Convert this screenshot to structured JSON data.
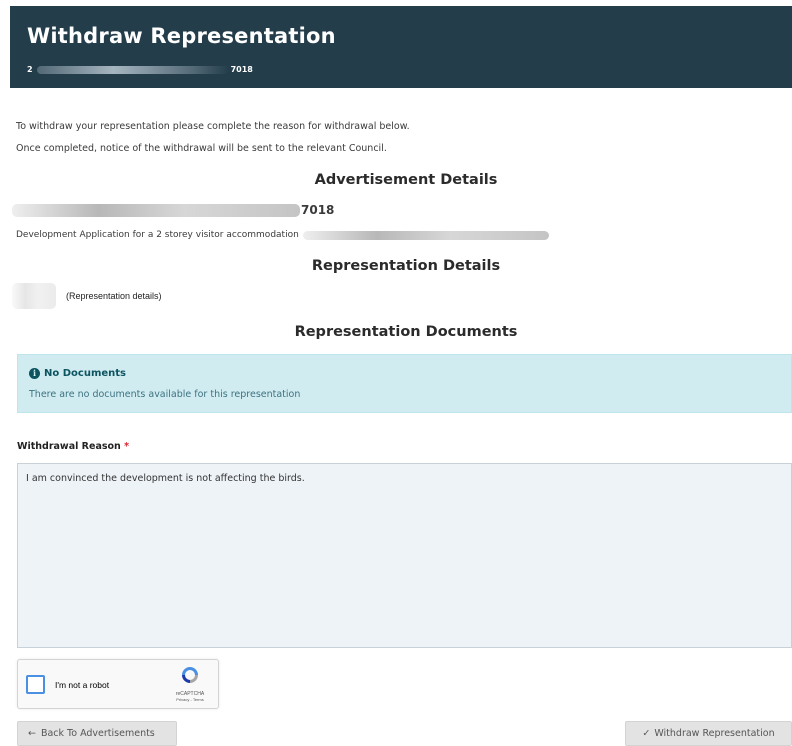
{
  "header": {
    "title": "Withdraw Representation",
    "ref_prefix": "2",
    "ref_suffix": "7018"
  },
  "intro": {
    "line1": "To withdraw your representation please complete the reason for withdrawal below.",
    "line2": "Once completed, notice of the withdrawal will be sent to the relevant Council."
  },
  "advertisement": {
    "heading": "Advertisement Details",
    "ref_suffix": "7018",
    "description": "Development Application for a 2 storey visitor accommodation"
  },
  "representation": {
    "heading": "Representation Details",
    "details_text": "(Representation details)"
  },
  "documents": {
    "heading": "Representation Documents",
    "alert_title": "No Documents",
    "alert_text": "There are no documents available for this representation"
  },
  "form": {
    "reason_label": "Withdrawal Reason",
    "required_marker": "*",
    "reason_value": "I am convinced the development is not affecting the birds."
  },
  "captcha": {
    "label": "I'm not a robot",
    "brand": "reCAPTCHA",
    "terms": "Privacy - Terms"
  },
  "buttons": {
    "back_icon": "←",
    "back_label": "Back To Advertisements",
    "withdraw_icon": "✓",
    "withdraw_label": "Withdraw Representation"
  },
  "colors": {
    "header_bg": "#233d4b",
    "alert_bg": "#d1ecf1",
    "alert_text": "#0c5460",
    "required": "#d9232e",
    "textarea_bg": "#eef3f8",
    "checkbox_border": "#4a90e2"
  },
  "icons": {
    "info": "info-circle-icon",
    "captcha_logo": "recaptcha-logo-icon"
  }
}
